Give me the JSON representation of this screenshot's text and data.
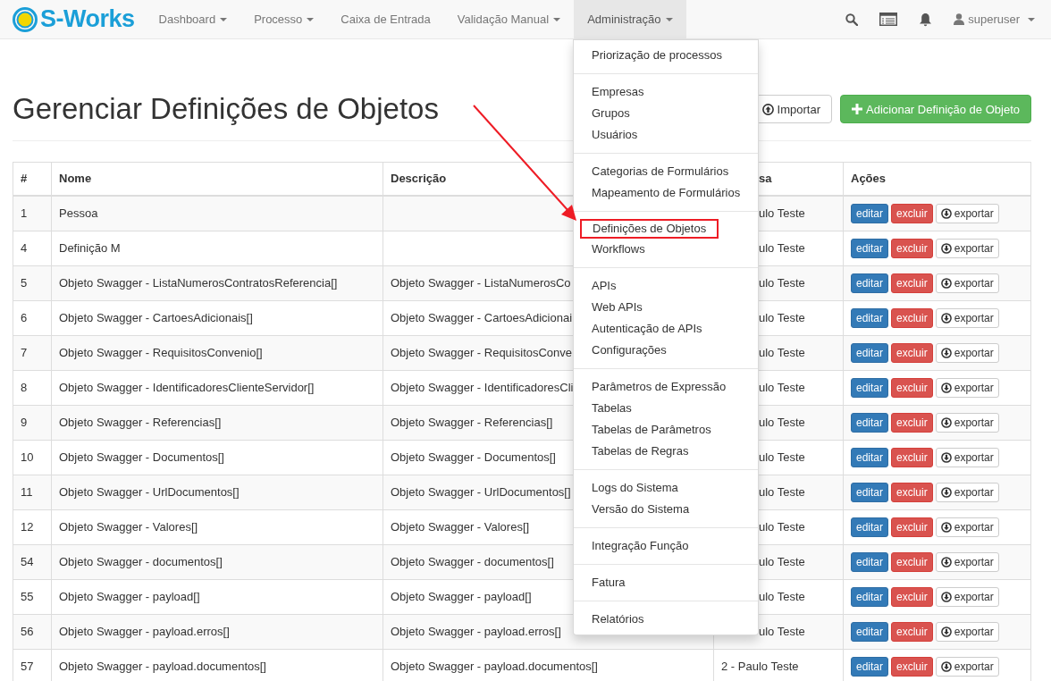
{
  "navbar": {
    "brand": "S-Works",
    "items": [
      {
        "label": "Dashboard",
        "dropdown": true,
        "selected": false
      },
      {
        "label": "Processo",
        "dropdown": true,
        "selected": false
      },
      {
        "label": "Caixa de Entrada",
        "dropdown": false,
        "selected": false
      },
      {
        "label": "Validação Manual",
        "dropdown": true,
        "selected": false
      },
      {
        "label": "Administração",
        "dropdown": true,
        "selected": true
      }
    ],
    "user": "superuser"
  },
  "page": {
    "title": "Gerenciar Definições de Objetos",
    "buttons": [
      {
        "kind": "default",
        "label": "Importar"
      },
      {
        "kind": "success",
        "label": "Adicionar Definição de Objeto"
      }
    ]
  },
  "table": {
    "columns": [
      {
        "label": "#",
        "partly_hidden": false
      },
      {
        "label": "Nome",
        "partly_hidden": false
      },
      {
        "label": "Descrição",
        "partly_hidden": false
      },
      {
        "label": "sa",
        "partly_hidden": true
      },
      {
        "label": "Ações",
        "partly_hidden": false
      }
    ],
    "rows": [
      {
        "id": "1",
        "name": "Pessoa",
        "company": "ulo Teste",
        "partly_hidden": true,
        "actions": [
          {
            "kind": "primary",
            "label": "editar"
          },
          {
            "kind": "danger",
            "label": "excluir"
          },
          {
            "kind": "export",
            "label": "exportar"
          }
        ]
      },
      {
        "id": "4",
        "name": "Definição M",
        "company": "ulo Teste",
        "partly_hidden": true,
        "actions": [
          {
            "kind": "primary",
            "label": "editar"
          },
          {
            "kind": "danger",
            "label": "excluir"
          },
          {
            "kind": "export",
            "label": "exportar"
          }
        ]
      },
      {
        "id": "5",
        "name": "Objeto Swagger - ListaNumerosContratosReferencia[]",
        "description": "Objeto Swagger - ListaNumerosCo",
        "company": "ulo Teste",
        "partly_hidden": true,
        "actions": [
          {
            "kind": "primary",
            "label": "editar"
          },
          {
            "kind": "danger",
            "label": "excluir"
          },
          {
            "kind": "export",
            "label": "exportar"
          }
        ]
      },
      {
        "id": "6",
        "name": "Objeto Swagger - CartoesAdicionais[]",
        "description": "Objeto Swagger - CartoesAdicionai",
        "company": "ulo Teste",
        "partly_hidden": true,
        "actions": [
          {
            "kind": "primary",
            "label": "editar"
          },
          {
            "kind": "danger",
            "label": "excluir"
          },
          {
            "kind": "export",
            "label": "exportar"
          }
        ]
      },
      {
        "id": "7",
        "name": "Objeto Swagger - RequisitosConvenio[]",
        "description": "Objeto Swagger - RequisitosConve",
        "company": "ulo Teste",
        "partly_hidden": true,
        "actions": [
          {
            "kind": "primary",
            "label": "editar"
          },
          {
            "kind": "danger",
            "label": "excluir"
          },
          {
            "kind": "export",
            "label": "exportar"
          }
        ]
      },
      {
        "id": "8",
        "name": "Objeto Swagger - IdentificadoresClienteServidor[]",
        "description": "Objeto Swagger - IdentificadoresCli",
        "company": "ulo Teste",
        "partly_hidden": true,
        "actions": [
          {
            "kind": "primary",
            "label": "editar"
          },
          {
            "kind": "danger",
            "label": "excluir"
          },
          {
            "kind": "export",
            "label": "exportar"
          }
        ]
      },
      {
        "id": "9",
        "name": "Objeto Swagger - Referencias[]",
        "description": "Objeto Swagger - Referencias[]",
        "company": "ulo Teste",
        "partly_hidden": true,
        "actions": [
          {
            "kind": "primary",
            "label": "editar"
          },
          {
            "kind": "danger",
            "label": "excluir"
          },
          {
            "kind": "export",
            "label": "exportar"
          }
        ]
      },
      {
        "id": "10",
        "name": "Objeto Swagger - Documentos[]",
        "description": "Objeto Swagger - Documentos[]",
        "company": "ulo Teste",
        "partly_hidden": true,
        "actions": [
          {
            "kind": "primary",
            "label": "editar"
          },
          {
            "kind": "danger",
            "label": "excluir"
          },
          {
            "kind": "export",
            "label": "exportar"
          }
        ]
      },
      {
        "id": "11",
        "name": "Objeto Swagger - UrlDocumentos[]",
        "description": "Objeto Swagger - UrlDocumentos[]",
        "company": "ulo Teste",
        "partly_hidden": true,
        "actions": [
          {
            "kind": "primary",
            "label": "editar"
          },
          {
            "kind": "danger",
            "label": "excluir"
          },
          {
            "kind": "export",
            "label": "exportar"
          }
        ]
      },
      {
        "id": "12",
        "name": "Objeto Swagger - Valores[]",
        "description": "Objeto Swagger - Valores[]",
        "company": "ulo Teste",
        "partly_hidden": true,
        "actions": [
          {
            "kind": "primary",
            "label": "editar"
          },
          {
            "kind": "danger",
            "label": "excluir"
          },
          {
            "kind": "export",
            "label": "exportar"
          }
        ]
      },
      {
        "id": "54",
        "name": "Objeto Swagger - documentos[]",
        "description": "Objeto Swagger - documentos[]",
        "company": "ulo Teste",
        "partly_hidden": true,
        "actions": [
          {
            "kind": "primary",
            "label": "editar"
          },
          {
            "kind": "danger",
            "label": "excluir"
          },
          {
            "kind": "export",
            "label": "exportar"
          }
        ]
      },
      {
        "id": "55",
        "name": "Objeto Swagger - payload[]",
        "description": "Objeto Swagger - payload[]",
        "company": "ulo Teste",
        "partly_hidden": true,
        "actions": [
          {
            "kind": "primary",
            "label": "editar"
          },
          {
            "kind": "danger",
            "label": "excluir"
          },
          {
            "kind": "export",
            "label": "exportar"
          }
        ]
      },
      {
        "id": "56",
        "name": "Objeto Swagger - payload.erros[]",
        "description": "Objeto Swagger - payload.erros[]",
        "company": "ulo Teste",
        "partly_hidden": true,
        "actions": [
          {
            "kind": "primary",
            "label": "editar"
          },
          {
            "kind": "danger",
            "label": "excluir"
          },
          {
            "kind": "export",
            "label": "exportar"
          }
        ]
      },
      {
        "id": "57",
        "name": "Objeto Swagger - payload.documentos[]",
        "description": "Objeto Swagger - payload.documentos[]",
        "company": "2 - Paulo Teste",
        "partly_hidden": false,
        "actions": [
          {
            "kind": "primary",
            "label": "editar"
          },
          {
            "kind": "danger",
            "label": "excluir"
          },
          {
            "kind": "export",
            "label": "exportar"
          }
        ]
      }
    ]
  },
  "menu": {
    "groups": [
      [
        {
          "label": "Priorização de processos",
          "highlighted": false
        }
      ],
      [
        {
          "label": "Empresas",
          "highlighted": false
        },
        {
          "label": "Grupos",
          "highlighted": false
        },
        {
          "label": "Usuários",
          "highlighted": false
        }
      ],
      [
        {
          "label": "Categorias de Formulários",
          "highlighted": false
        },
        {
          "label": "Mapeamento de Formulários",
          "highlighted": false
        }
      ],
      [
        {
          "label": "Definições de Objetos",
          "highlighted": true
        },
        {
          "label": "Workflows",
          "highlighted": false
        }
      ],
      [
        {
          "label": "APIs",
          "highlighted": false
        },
        {
          "label": "Web APIs",
          "highlighted": false
        },
        {
          "label": "Autenticação de APIs",
          "highlighted": false
        },
        {
          "label": "Configurações",
          "highlighted": false
        }
      ],
      [
        {
          "label": "Parâmetros de Expressão",
          "highlighted": false
        },
        {
          "label": "Tabelas",
          "highlighted": false
        },
        {
          "label": "Tabelas de Parâmetros",
          "highlighted": false
        },
        {
          "label": "Tabelas de Regras",
          "highlighted": false
        }
      ],
      [
        {
          "label": "Logs do Sistema",
          "highlighted": false
        },
        {
          "label": "Versão do Sistema",
          "highlighted": false
        }
      ],
      [
        {
          "label": "Integração Função",
          "highlighted": false
        }
      ],
      [
        {
          "label": "Fatura",
          "highlighted": false
        }
      ],
      [
        {
          "label": "Relatórios",
          "highlighted": false
        }
      ]
    ]
  }
}
